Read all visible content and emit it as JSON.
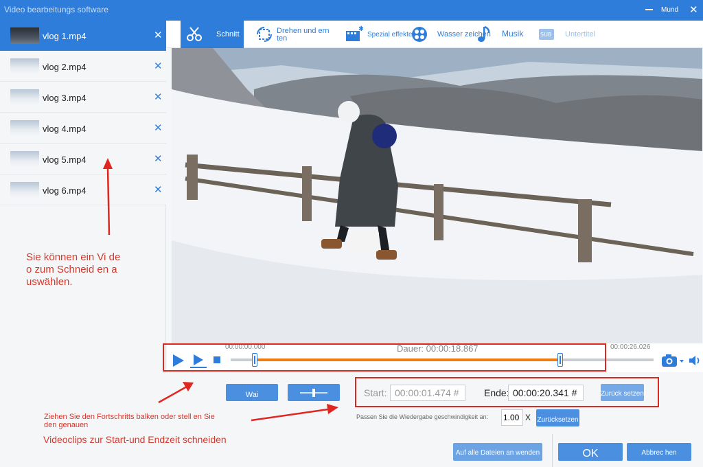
{
  "window": {
    "title": "Video bearbeitungs software",
    "user": "Mund",
    "accent": "#2e7ddb"
  },
  "files": [
    {
      "name": "vlog 1.mp4",
      "selected": true
    },
    {
      "name": "vlog 2.mp4",
      "selected": false
    },
    {
      "name": "vlog 3.mp4",
      "selected": false
    },
    {
      "name": "vlog 4.mp4",
      "selected": false
    },
    {
      "name": "vlog 5.mp4",
      "selected": false
    },
    {
      "name": "vlog 6.mp4",
      "selected": false
    }
  ],
  "tabs": [
    {
      "label": "Schnitt",
      "icon": "scissors-icon",
      "active": true
    },
    {
      "label": "Drehen und ern ten",
      "icon": "rotate-icon"
    },
    {
      "label": "Spezial effekte",
      "icon": "magic-film-icon"
    },
    {
      "label": "Wasser zeichen",
      "icon": "watermark-icon"
    },
    {
      "label": "Musik",
      "icon": "music-note-icon"
    },
    {
      "label": "Untertitel",
      "icon": "subtitle-icon",
      "disabled": true
    }
  ],
  "timeline": {
    "start_time": "00:00:00.000",
    "duration": "Dauer: 00:00:18.867",
    "end_time": "00:00:26.026",
    "selection_start_fraction": 0.057,
    "selection_end_fraction": 0.78,
    "progress_color": "#f07c12"
  },
  "trim": {
    "start_label": "Start:",
    "start_value": "00:00:01.474 #",
    "end_label": "Ende:",
    "end_value": "00:00:20.341 #",
    "reset_label": "Zurück setzen"
  },
  "speed": {
    "label": "Passen Sie die Wiedergabe geschwindigkeit an:",
    "value": "1.00",
    "unit": "X",
    "reset_label": "Zurücksetzen"
  },
  "split_buttons": {
    "left_label": "Wai",
    "right_label": ""
  },
  "annotations": {
    "select_hint": "Sie können ein Vi deo zum Schneid en auswählen.",
    "drag_hint": "Ziehen Sie den Fortschritts balken oder stell en Sie den genauen",
    "cut_hint": "Videoclips zur Start-und Endzeit schneiden",
    "color": "#d23a2e"
  },
  "footer": {
    "apply_all": "Auf alle Dateien an wenden",
    "ok": "OK",
    "cancel": "Abbrec hen"
  }
}
